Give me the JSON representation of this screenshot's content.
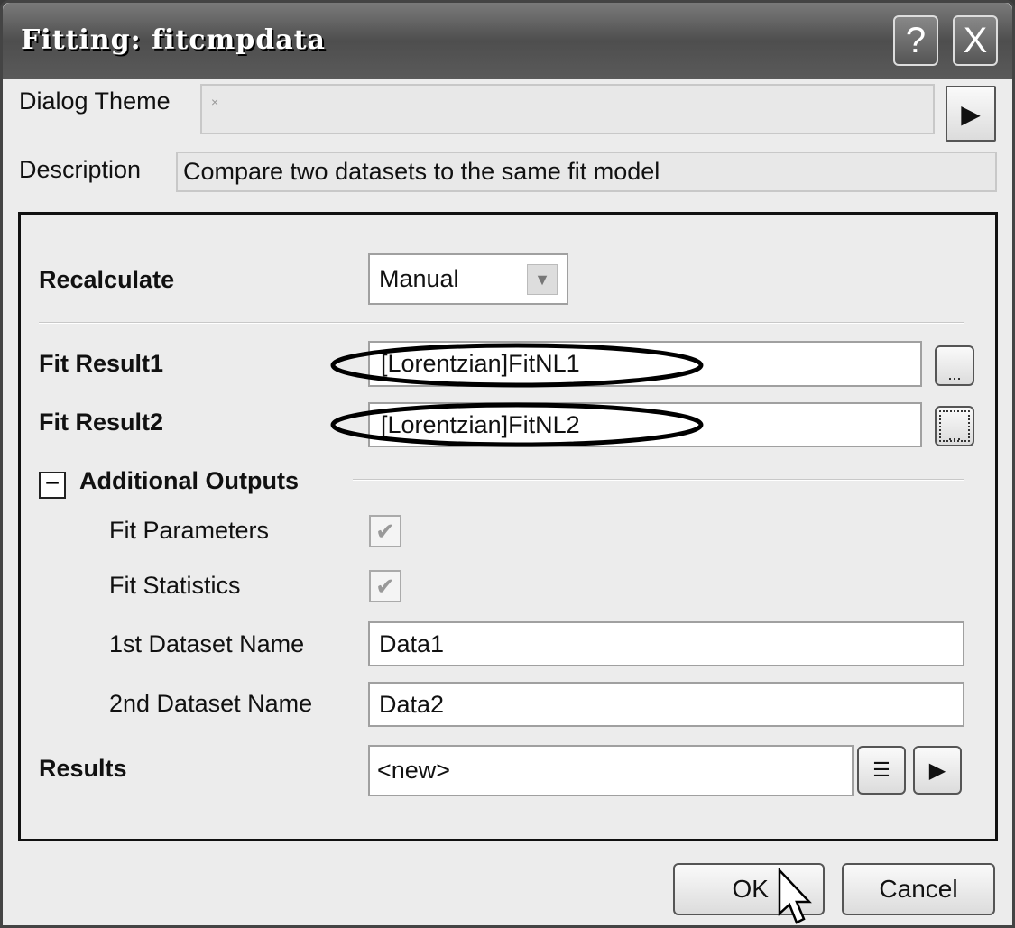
{
  "window": {
    "title": "Fitting: fitcmpdata",
    "help_label": "?",
    "close_label": "X"
  },
  "header": {
    "theme_label": "Dialog Theme",
    "theme_value": "×",
    "description_label": "Description",
    "description_value": "Compare two datasets to the same fit model"
  },
  "form": {
    "recalculate_label": "Recalculate",
    "recalculate_value": "Manual",
    "fit_result1_label": "Fit Result1",
    "fit_result1_value": "[Lorentzian]FitNL1",
    "fit_result2_label": "Fit Result2",
    "fit_result2_value": "[Lorentzian]FitNL2",
    "browse_label": "...",
    "additional_outputs_label": "Additional Outputs",
    "additional_outputs_toggle": "−",
    "fit_parameters_label": "Fit Parameters",
    "fit_parameters_checked": true,
    "fit_statistics_label": "Fit Statistics",
    "fit_statistics_checked": true,
    "dataset1_label": "1st Dataset Name",
    "dataset1_value": "Data1",
    "dataset2_label": "2nd Dataset Name",
    "dataset2_value": "Data2",
    "results_label": "Results",
    "results_value": "<new>"
  },
  "footer": {
    "ok_label": "OK",
    "cancel_label": "Cancel"
  }
}
